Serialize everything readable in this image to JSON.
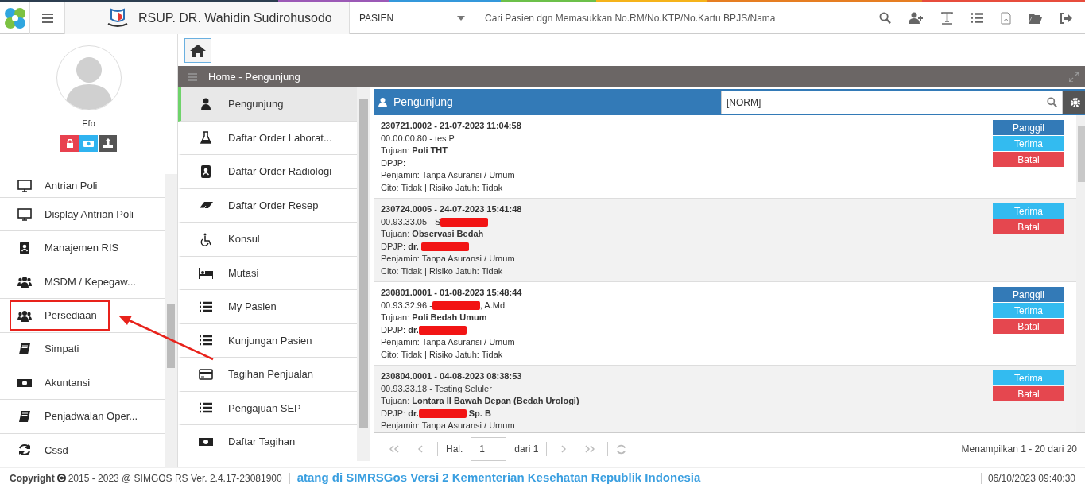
{
  "header": {
    "app_title": "RSUP. DR. Wahidin Sudirohusodo",
    "search_category": "PASIEN",
    "search_placeholder": "Cari Pasien dgn Memasukkan No.RM/No.KTP/No.Kartu BPJS/Nama"
  },
  "user": {
    "name": "Efo"
  },
  "sidebar": {
    "items": [
      {
        "label": "Antrian Poli",
        "highlighted": false
      },
      {
        "label": "Display Antrian Poli",
        "highlighted": false
      },
      {
        "label": "Manajemen RIS",
        "highlighted": false
      },
      {
        "label": "MSDM / Kepegaw...",
        "highlighted": false
      },
      {
        "label": "Persediaan",
        "highlighted": true
      },
      {
        "label": "Simpati",
        "highlighted": false
      },
      {
        "label": "Akuntansi",
        "highlighted": false
      },
      {
        "label": "Penjadwalan Oper...",
        "highlighted": false
      },
      {
        "label": "Cssd",
        "highlighted": false
      }
    ]
  },
  "breadcrumb": "Home - Pengunjung",
  "menu": {
    "items": [
      {
        "label": "Pengunjung",
        "selected": true
      },
      {
        "label": "Daftar Order Laborat...",
        "selected": false
      },
      {
        "label": "Daftar Order Radiologi",
        "selected": false
      },
      {
        "label": "Daftar Order Resep",
        "selected": false
      },
      {
        "label": "Konsul",
        "selected": false
      },
      {
        "label": "Mutasi",
        "selected": false
      },
      {
        "label": "My Pasien",
        "selected": false
      },
      {
        "label": "Kunjungan Pasien",
        "selected": false
      },
      {
        "label": "Tagihan Penjualan",
        "selected": false
      },
      {
        "label": "Pengajuan SEP",
        "selected": false
      },
      {
        "label": "Daftar Tagihan",
        "selected": false
      }
    ]
  },
  "panel": {
    "title": "Pengunjung",
    "filter_value": "[NORM]"
  },
  "visits": [
    {
      "lines": [
        [
          {
            "kind": "bold",
            "text": "230721.0002 - 21-07-2023 11:04:58"
          }
        ],
        [
          {
            "kind": "text",
            "text": "00.00.00.80 - tes P"
          }
        ],
        [
          {
            "kind": "text",
            "text": "Tujuan: "
          },
          {
            "kind": "bold",
            "text": "Poli THT"
          }
        ],
        [
          {
            "kind": "text",
            "text": "DPJP:"
          }
        ],
        [
          {
            "kind": "text",
            "text": "Penjamin: Tanpa Asuransi / Umum"
          }
        ],
        [
          {
            "kind": "text",
            "text": "Cito: Tidak | Risiko Jatuh: Tidak"
          }
        ]
      ],
      "buttons": [
        {
          "label": "Panggil",
          "kind": "call"
        },
        {
          "label": "Terima",
          "kind": "accept"
        },
        {
          "label": "Batal",
          "kind": "cancel"
        }
      ]
    },
    {
      "lines": [
        [
          {
            "kind": "bold",
            "text": "230724.0005 - 24-07-2023 15:41:48"
          }
        ],
        [
          {
            "kind": "text",
            "text": "00.93.33.05 - S"
          },
          {
            "kind": "redaction"
          }
        ],
        [
          {
            "kind": "text",
            "text": "Tujuan: "
          },
          {
            "kind": "bold",
            "text": "Observasi Bedah"
          }
        ],
        [
          {
            "kind": "text",
            "text": "DPJP: "
          },
          {
            "kind": "bold",
            "text": "dr. "
          },
          {
            "kind": "redaction"
          }
        ],
        [
          {
            "kind": "text",
            "text": "Penjamin: Tanpa Asuransi / Umum"
          }
        ],
        [
          {
            "kind": "text",
            "text": "Cito: Tidak | Risiko Jatuh: Tidak"
          }
        ]
      ],
      "buttons": [
        {
          "label": "Terima",
          "kind": "accept"
        },
        {
          "label": "Batal",
          "kind": "cancel"
        }
      ]
    },
    {
      "lines": [
        [
          {
            "kind": "bold",
            "text": "230801.0001 - 01-08-2023 15:48:44"
          }
        ],
        [
          {
            "kind": "text",
            "text": "00.93.32.96 -"
          },
          {
            "kind": "redaction"
          },
          {
            "kind": "text",
            "text": ", A.Md"
          }
        ],
        [
          {
            "kind": "text",
            "text": "Tujuan: "
          },
          {
            "kind": "bold",
            "text": "Poli Bedah Umum"
          }
        ],
        [
          {
            "kind": "text",
            "text": "DPJP: "
          },
          {
            "kind": "bold",
            "text": "dr."
          },
          {
            "kind": "redaction"
          }
        ],
        [
          {
            "kind": "text",
            "text": "Penjamin: Tanpa Asuransi / Umum"
          }
        ],
        [
          {
            "kind": "text",
            "text": "Cito: Tidak | Risiko Jatuh: Tidak"
          }
        ]
      ],
      "buttons": [
        {
          "label": "Panggil",
          "kind": "call"
        },
        {
          "label": "Terima",
          "kind": "accept"
        },
        {
          "label": "Batal",
          "kind": "cancel"
        }
      ]
    },
    {
      "lines": [
        [
          {
            "kind": "bold",
            "text": "230804.0001 - 04-08-2023 08:38:53"
          }
        ],
        [
          {
            "kind": "text",
            "text": "00.93.33.18 - Testing Seluler"
          }
        ],
        [
          {
            "kind": "text",
            "text": "Tujuan: "
          },
          {
            "kind": "bold",
            "text": "Lontara II Bawah Depan (Bedah Urologi)"
          }
        ],
        [
          {
            "kind": "text",
            "text": "DPJP: "
          },
          {
            "kind": "bold",
            "text": "dr."
          },
          {
            "kind": "redaction"
          },
          {
            "kind": "bold",
            "text": " Sp. B"
          }
        ],
        [
          {
            "kind": "text",
            "text": "Penjamin: Tanpa Asuransi / Umum"
          }
        ]
      ],
      "buttons": [
        {
          "label": "Terima",
          "kind": "accept"
        },
        {
          "label": "Batal",
          "kind": "cancel"
        }
      ]
    }
  ],
  "pager": {
    "page_label": "Hal.",
    "page": "1",
    "of_label": "dari 1",
    "summary": "Menampilkan 1 - 20 dari 20"
  },
  "footer": {
    "copyright": "Copyright",
    "version": "2015 - 2023 @ SIMGOS RS Ver. 2.4.17-23081900",
    "marquee": "atang di SIMRSGos Versi 2 Kementerian Kesehatan Republik Indonesia",
    "datetime": "06/10/2023 09:40:30"
  }
}
